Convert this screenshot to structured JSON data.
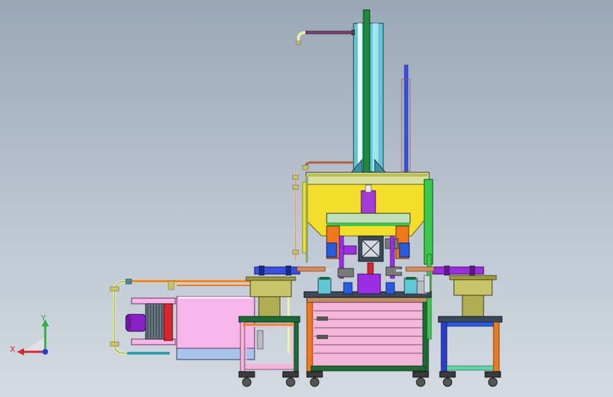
{
  "viewport": {
    "background_top": "#9aa7b6",
    "background_bottom": "#d3dae2"
  },
  "triad": {
    "x_label": "X",
    "y_label": "Y",
    "x_color": "#d8262c",
    "y_color": "#2bb04a",
    "z_color": "#2a3fc9"
  },
  "palette": {
    "column": "#5fc7d6",
    "column_core": "#1f8a3c",
    "press_head": "#f2de2a",
    "press_frame_green": "#3cc84a",
    "tank": "#f6b6ea",
    "motor": "#8b20c8",
    "hopper": "#9c9a3c",
    "base_blue": "#a9c4ea",
    "cabinet_pink": "#f3b6d8",
    "stand_orange": "#f07a1a",
    "stand_blue": "#2a3fc9",
    "stand_dark_green": "#1d6a36",
    "purple_block": "#9a2ee0",
    "caster": "#3a3a3a"
  }
}
